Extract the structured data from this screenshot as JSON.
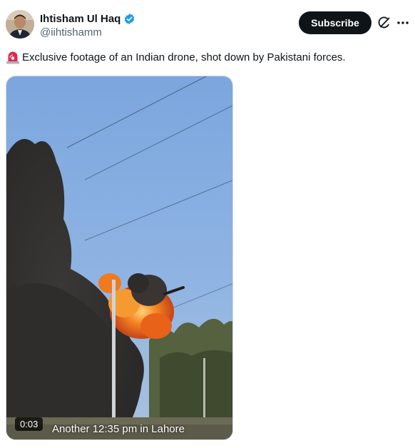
{
  "author": {
    "display_name": "Ihtisham Ul Haq",
    "handle": "@iihtishamm",
    "verified": true
  },
  "actions": {
    "subscribe_label": "Subscribe",
    "grok_icon": "grok-icon",
    "more_icon": "more-horizontal-icon"
  },
  "tweet": {
    "emoji": "siren-emoji",
    "text": "Exclusive footage of an Indian drone, shot down by Pakistani forces."
  },
  "media": {
    "type": "video",
    "duration": "0:03",
    "caption": "Another 12:35 pm in Lahore"
  },
  "colors": {
    "text_primary": "#0f1419",
    "text_secondary": "#536471",
    "verified_blue": "#1d9bf0",
    "subscribe_bg": "#0f1419"
  }
}
